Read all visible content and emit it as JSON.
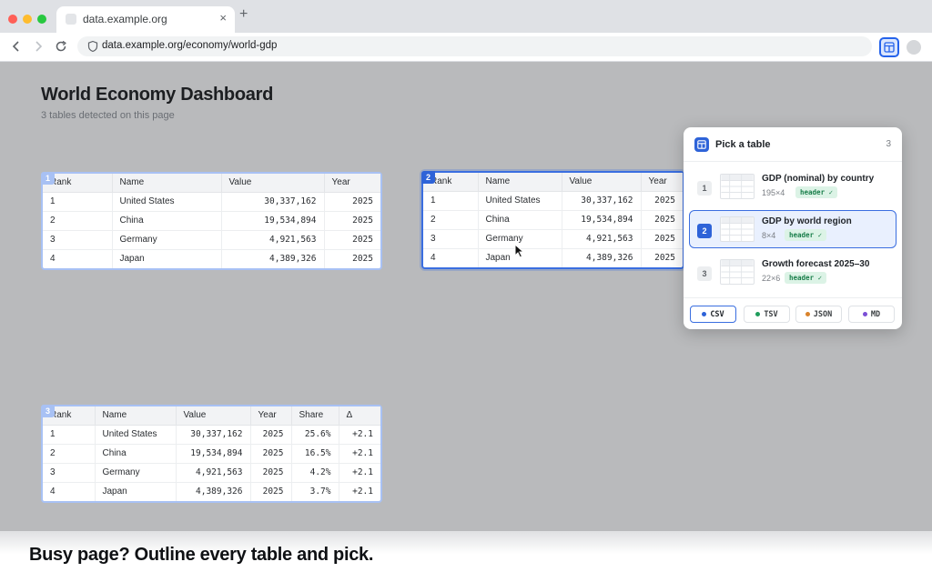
{
  "browser": {
    "tab_title": "data.example.org",
    "tab_close": "×",
    "new_tab": "+",
    "url": "data.example.org/economy/world-gdp",
    "back": "‹",
    "forward": "›",
    "reload": "↻"
  },
  "page": {
    "title": "World Economy Dashboard",
    "subtitle": "3 tables detected on this page"
  },
  "tables": [
    {
      "badge": "1",
      "columns": [
        "Rank",
        "Name",
        "Value",
        "Year"
      ],
      "rows": [
        [
          "1",
          "United States",
          "30,337,162",
          "2025"
        ],
        [
          "2",
          "China",
          "19,534,894",
          "2025"
        ],
        [
          "3",
          "Germany",
          "4,921,563",
          "2025"
        ],
        [
          "4",
          "Japan",
          "4,389,326",
          "2025"
        ]
      ]
    },
    {
      "badge": "2",
      "columns": [
        "Rank",
        "Name",
        "Value",
        "Year"
      ],
      "rows": [
        [
          "1",
          "United States",
          "30,337,162",
          "2025"
        ],
        [
          "2",
          "China",
          "19,534,894",
          "2025"
        ],
        [
          "3",
          "Germany",
          "4,921,563",
          "2025"
        ],
        [
          "4",
          "Japan",
          "4,389,326",
          "2025"
        ]
      ]
    },
    {
      "badge": "3",
      "columns": [
        "Rank",
        "Name",
        "Value",
        "Year",
        "Share",
        "Δ"
      ],
      "rows": [
        [
          "1",
          "United States",
          "30,337,162",
          "2025",
          "25.6%",
          "+2.1"
        ],
        [
          "2",
          "China",
          "19,534,894",
          "2025",
          "16.5%",
          "+2.1"
        ],
        [
          "3",
          "Germany",
          "4,921,563",
          "2025",
          "4.2%",
          "+2.1"
        ],
        [
          "4",
          "Japan",
          "4,389,326",
          "2025",
          "3.7%",
          "+2.1"
        ]
      ]
    }
  ],
  "popup": {
    "title": "Pick a table",
    "count": "3",
    "items": [
      {
        "num": "1",
        "label": "GDP (nominal) by country",
        "dims": "195×4",
        "tag": "header ✓",
        "active": false
      },
      {
        "num": "2",
        "label": "GDP by world region",
        "dims": "8×4",
        "tag": "header ✓",
        "active": true
      },
      {
        "num": "3",
        "label": "Growth forecast 2025–30",
        "dims": "22×6",
        "tag": "header ✓",
        "active": false
      }
    ],
    "formats": [
      {
        "label": "CSV",
        "color": "#2e63d8",
        "active": true
      },
      {
        "label": "TSV",
        "color": "#1f9d5c",
        "active": false
      },
      {
        "label": "JSON",
        "color": "#d9822b",
        "active": false
      },
      {
        "label": "MD",
        "color": "#7b4fd6",
        "active": false
      }
    ]
  },
  "caption": "Busy page? Outline every table and pick.",
  "colors": {
    "accent": "#2e63d8",
    "outline": "#a8c1f4",
    "tag_bg": "#dcf3e6",
    "tag_text": "#1a7f4b"
  }
}
